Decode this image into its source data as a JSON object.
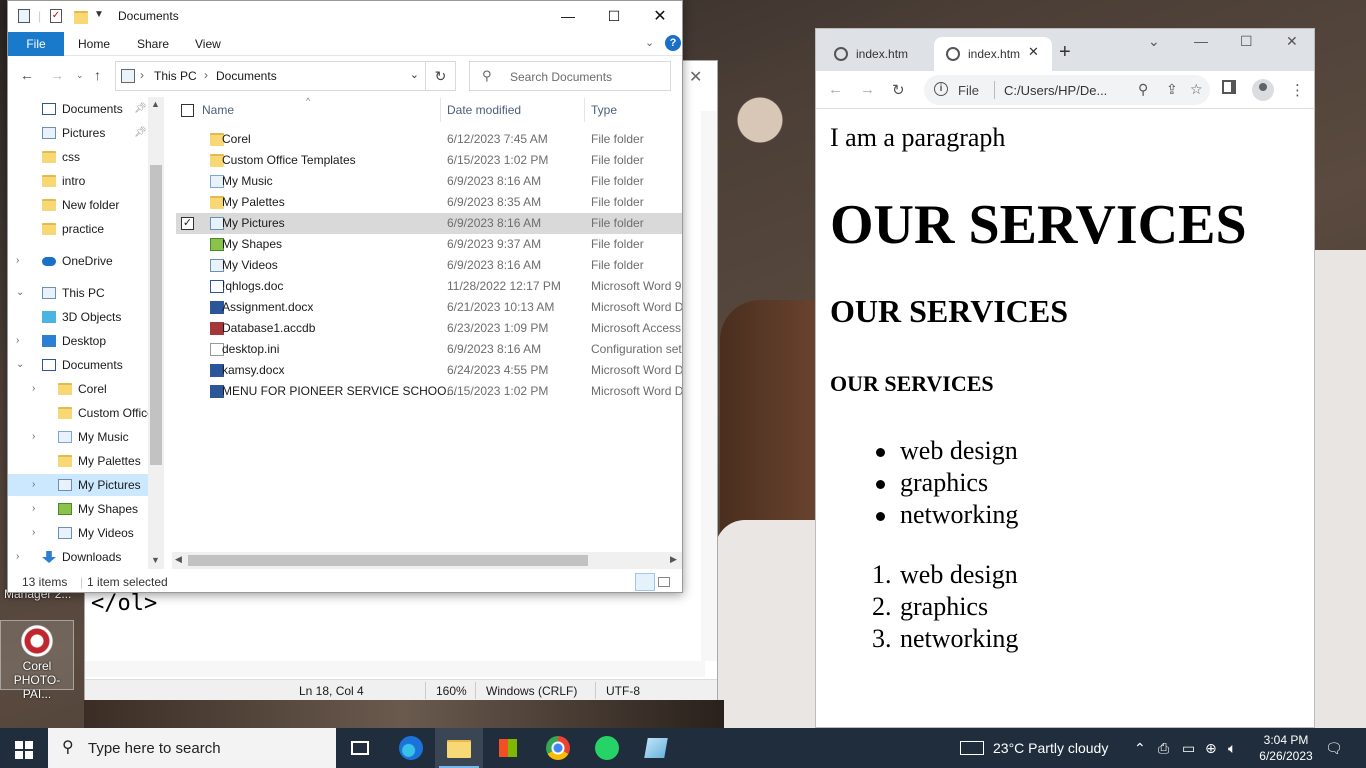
{
  "explorer": {
    "title": "Documents",
    "ribbon_tabs": [
      "File",
      "Home",
      "Share",
      "View"
    ],
    "address": {
      "crumbs": [
        "This PC",
        "Documents"
      ]
    },
    "search_placeholder": "Search Documents",
    "columns": {
      "name": "Name",
      "date": "Date modified",
      "type": "Type"
    },
    "nav_items": [
      {
        "label": "Documents",
        "icon": "documents-icon",
        "pinned": true,
        "indent": 0,
        "chev": ""
      },
      {
        "label": "Pictures",
        "icon": "pictures-icon",
        "pinned": true,
        "indent": 0,
        "chev": ""
      },
      {
        "label": "css",
        "icon": "folder-icon",
        "pinned": false,
        "indent": 0,
        "chev": ""
      },
      {
        "label": "intro",
        "icon": "folder-icon",
        "pinned": false,
        "indent": 0,
        "chev": ""
      },
      {
        "label": "New folder",
        "icon": "folder-icon",
        "pinned": false,
        "indent": 0,
        "chev": ""
      },
      {
        "label": "practice",
        "icon": "folder-icon",
        "pinned": false,
        "indent": 0,
        "chev": ""
      },
      {
        "label": "OneDrive",
        "icon": "onedrive-icon",
        "pinned": false,
        "indent": 0,
        "chev": ">"
      },
      {
        "label": "This PC",
        "icon": "this-pc-icon",
        "pinned": false,
        "indent": 0,
        "chev": "v"
      },
      {
        "label": "3D Objects",
        "icon": "3d-objects-icon",
        "pinned": false,
        "indent": 1,
        "chev": ""
      },
      {
        "label": "Desktop",
        "icon": "desktop-folder-icon",
        "pinned": false,
        "indent": 1,
        "chev": ">"
      },
      {
        "label": "Documents",
        "icon": "documents-icon",
        "pinned": false,
        "indent": 1,
        "chev": "v"
      },
      {
        "label": "Corel",
        "icon": "folder-icon",
        "pinned": false,
        "indent": 2,
        "chev": ">"
      },
      {
        "label": "Custom Office",
        "icon": "folder-icon",
        "pinned": false,
        "indent": 2,
        "chev": ""
      },
      {
        "label": "My Music",
        "icon": "music-folder-icon",
        "pinned": false,
        "indent": 2,
        "chev": ">"
      },
      {
        "label": "My Palettes",
        "icon": "folder-icon",
        "pinned": false,
        "indent": 2,
        "chev": ""
      },
      {
        "label": "My Pictures",
        "icon": "pictures-folder-icon",
        "pinned": false,
        "indent": 2,
        "chev": ">",
        "selected": true
      },
      {
        "label": "My Shapes",
        "icon": "shapes-folder-icon",
        "pinned": false,
        "indent": 2,
        "chev": ">"
      },
      {
        "label": "My Videos",
        "icon": "videos-folder-icon",
        "pinned": false,
        "indent": 2,
        "chev": ">"
      },
      {
        "label": "Downloads",
        "icon": "downloads-icon",
        "pinned": false,
        "indent": 1,
        "chev": ">"
      }
    ],
    "files": [
      {
        "name": "Corel",
        "date": "6/12/2023 7:45 AM",
        "type": "File folder",
        "icon": "folder-icon"
      },
      {
        "name": "Custom Office Templates",
        "date": "6/15/2023 1:02 PM",
        "type": "File folder",
        "icon": "folder-icon"
      },
      {
        "name": "My Music",
        "date": "6/9/2023 8:16 AM",
        "type": "File folder",
        "icon": "music-folder-icon"
      },
      {
        "name": "My Palettes",
        "date": "6/9/2023 8:35 AM",
        "type": "File folder",
        "icon": "folder-icon"
      },
      {
        "name": "My Pictures",
        "date": "6/9/2023 8:16 AM",
        "type": "File folder",
        "icon": "pictures-folder-icon",
        "selected": true
      },
      {
        "name": "My Shapes",
        "date": "6/9/2023 9:37 AM",
        "type": "File folder",
        "icon": "shapes-folder-icon"
      },
      {
        "name": "My Videos",
        "date": "6/9/2023 8:16 AM",
        "type": "File folder",
        "icon": "videos-folder-icon"
      },
      {
        "name": "!qhlogs.doc",
        "date": "11/28/2022 12:17 PM",
        "type": "Microsoft Word 9",
        "icon": "doc-file-icon"
      },
      {
        "name": "Assignment.docx",
        "date": "6/21/2023 10:13 AM",
        "type": "Microsoft Word D",
        "icon": "word-file-icon"
      },
      {
        "name": "Database1.accdb",
        "date": "6/23/2023 1:09 PM",
        "type": "Microsoft Access",
        "icon": "access-file-icon"
      },
      {
        "name": "desktop.ini",
        "date": "6/9/2023 8:16 AM",
        "type": "Configuration set",
        "icon": "ini-file-icon"
      },
      {
        "name": "kamsy.docx",
        "date": "6/24/2023 4:55 PM",
        "type": "Microsoft Word D",
        "icon": "word-file-icon"
      },
      {
        "name": "MENU FOR PIONEER SERVICE SCHOO...",
        "date": "6/15/2023 1:02 PM",
        "type": "Microsoft Word D",
        "icon": "word-file-icon"
      }
    ],
    "status": {
      "count": "13 items",
      "selected": "1 item selected"
    }
  },
  "notepad": {
    "code_line": "</ol>",
    "status": {
      "position": "Ln 18, Col 4",
      "zoom": "160%",
      "line_ending": "Windows (CRLF)",
      "encoding": "UTF-8"
    }
  },
  "desktop": {
    "partial_label": "Manager 2...",
    "icon_label": "Corel PHOTO-PAI..."
  },
  "chrome": {
    "tabs": [
      "index.htm",
      "index.htm"
    ],
    "omnibox": {
      "scheme_label": "File",
      "url": "C:/Users/HP/De..."
    },
    "page": {
      "paragraph": "I am a paragraph",
      "h1": "OUR SERVICES",
      "h2": "OUR SERVICES",
      "h3": "OUR SERVICES",
      "ul": [
        "web design",
        "graphics",
        "networking"
      ],
      "ol": [
        "web design",
        "graphics",
        "networking"
      ]
    }
  },
  "taskbar": {
    "search_placeholder": "Type here to search",
    "weather": "23°C  Partly cloudy",
    "time": "3:04 PM",
    "date": "6/26/2023"
  }
}
